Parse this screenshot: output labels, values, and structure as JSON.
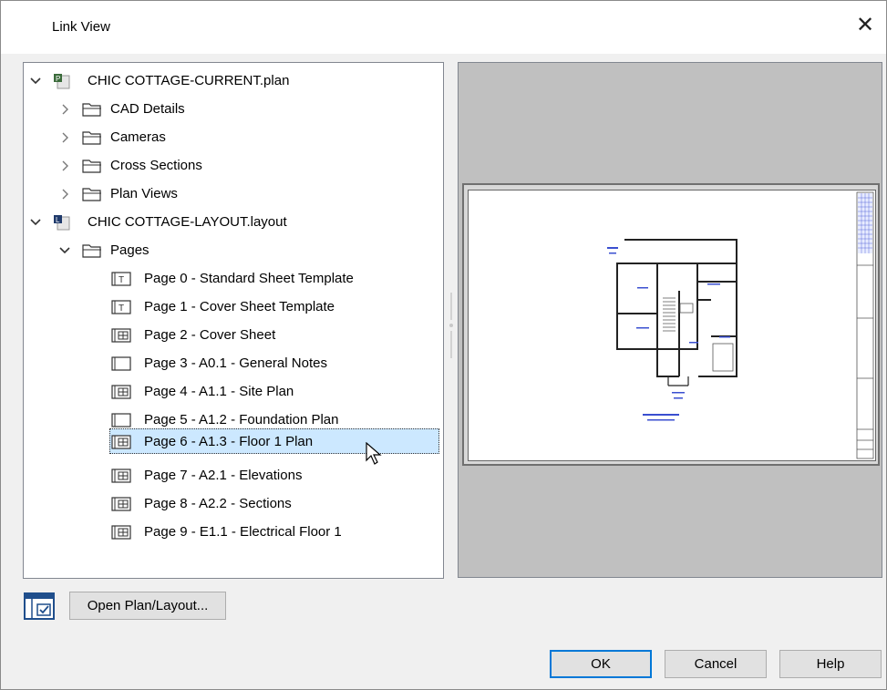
{
  "dialog": {
    "title": "Link View",
    "close_glyph": "✕"
  },
  "tree": {
    "plan": {
      "label": "CHIC COTTAGE-CURRENT.plan",
      "children": [
        {
          "label": "CAD Details"
        },
        {
          "label": "Cameras"
        },
        {
          "label": "Cross Sections"
        },
        {
          "label": "Plan Views"
        }
      ]
    },
    "layout": {
      "label": "CHIC COTTAGE-LAYOUT.layout",
      "folder": "Pages",
      "pages": [
        {
          "label": "Page 0 - Standard Sheet Template",
          "icon": "template-page-icon"
        },
        {
          "label": "Page 1 - Cover Sheet Template",
          "icon": "template-page-icon"
        },
        {
          "label": "Page 2 - Cover Sheet",
          "icon": "page-with-view-icon"
        },
        {
          "label": "Page 3 - A0.1 - General Notes",
          "icon": "blank-page-icon"
        },
        {
          "label": "Page 4 - A1.1 - Site Plan",
          "icon": "page-with-view-icon"
        },
        {
          "label": "Page 5 - A1.2 - Foundation Plan",
          "icon": "blank-page-icon"
        },
        {
          "label": "Page 6 - A1.3 - Floor 1 Plan",
          "icon": "page-with-view-icon",
          "selected": true
        },
        {
          "label": "Page 7 - A2.1 - Elevations",
          "icon": "page-with-view-icon"
        },
        {
          "label": "Page 8 - A2.2 - Sections",
          "icon": "page-with-view-icon"
        },
        {
          "label": "Page 9 - E1.1 - Electrical Floor 1",
          "icon": "page-with-view-icon"
        }
      ]
    }
  },
  "buttons": {
    "open": "Open Plan/Layout...",
    "ok": "OK",
    "cancel": "Cancel",
    "help": "Help"
  },
  "colors": {
    "selection": "#cce8ff",
    "accent": "#0078d7",
    "preview_bg": "#c0c0c0"
  }
}
